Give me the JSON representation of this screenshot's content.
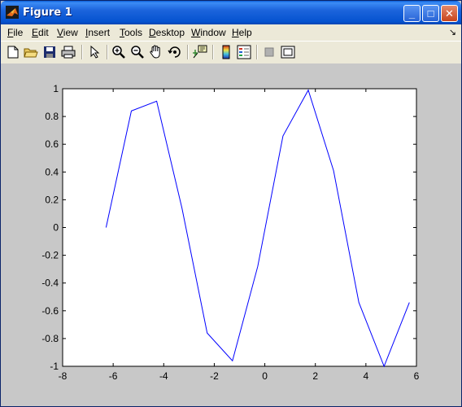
{
  "window": {
    "title": "Figure 1",
    "minimize_glyph": "_",
    "maximize_glyph": "□",
    "close_glyph": "✕"
  },
  "menu": {
    "items": [
      {
        "label": "File",
        "u": "F",
        "rest": "ile"
      },
      {
        "label": "Edit",
        "u": "E",
        "rest": "dit"
      },
      {
        "label": "View",
        "u": "V",
        "rest": "iew"
      },
      {
        "label": "Insert",
        "u": "I",
        "rest": "nsert"
      },
      {
        "label": "Tools",
        "u": "T",
        "rest": "ools"
      },
      {
        "label": "Desktop",
        "u": "D",
        "rest": "esktop"
      },
      {
        "label": "Window",
        "u": "W",
        "rest": "indow"
      },
      {
        "label": "Help",
        "u": "H",
        "rest": "elp"
      }
    ],
    "dock_arrow": "↘"
  },
  "toolbar": {
    "tools": [
      "new-file-icon",
      "open-folder-icon",
      "save-icon",
      "print-icon",
      "edit-plot-arrow-icon",
      "zoom-in-icon",
      "zoom-out-icon",
      "pan-hand-icon",
      "rotate-3d-icon",
      "data-cursor-icon",
      "colorbar-icon",
      "legend-icon",
      "hide-plot-tools-icon",
      "show-plot-tools-icon"
    ]
  },
  "chart_data": {
    "type": "line",
    "title": "",
    "xlabel": "",
    "ylabel": "",
    "xlim": [
      -8,
      6
    ],
    "ylim": [
      -1,
      1
    ],
    "xticks": [
      "-8",
      "-6",
      "-4",
      "-2",
      "0",
      "2",
      "4",
      "6"
    ],
    "yticks": [
      "-1",
      "-0.8",
      "-0.6",
      "-0.4",
      "-0.2",
      "0",
      "0.2",
      "0.4",
      "0.6",
      "0.8",
      "1"
    ],
    "grid": false,
    "series": [
      {
        "color": "#0000ff",
        "x": [
          -6.28,
          -5.28,
          -4.28,
          -3.28,
          -2.28,
          -1.28,
          -0.28,
          0.72,
          1.72,
          2.72,
          3.72,
          4.72,
          5.72
        ],
        "y": [
          0.0,
          0.84,
          0.91,
          0.14,
          -0.76,
          -0.96,
          -0.28,
          0.66,
          0.99,
          0.41,
          -0.54,
          -1.0,
          -0.54
        ]
      }
    ]
  }
}
